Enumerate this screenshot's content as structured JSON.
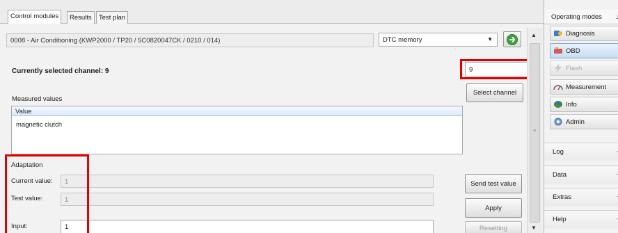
{
  "tabs": [
    {
      "label": "Control modules",
      "active": true
    },
    {
      "label": "Results",
      "active": false
    },
    {
      "label": "Test plan",
      "active": false
    }
  ],
  "module": {
    "name": "0008 - Air Conditioning  (KWP2000 / TP20 / 5C0820047CK  / 0210 / 014)",
    "function_select": "DTC memory",
    "go_icon": "green-arrow-right-icon"
  },
  "channel": {
    "title": "Currently selected channel: 9",
    "input_value": "9",
    "select_button": "Select channel"
  },
  "measured": {
    "heading": "Measured values",
    "column": "Value",
    "rows": [
      "magnetic clutch"
    ]
  },
  "adaptation": {
    "heading": "Adaptation",
    "current_label": "Current value:",
    "current_value": "1",
    "test_label": "Test value:",
    "test_value": "1",
    "input_label": "Input:",
    "input_value": "1",
    "send_button": "Send test value",
    "apply_button": "Apply",
    "reset_button": "Resetting"
  },
  "sidebar": {
    "header": "Operating modes",
    "pin_icon": "pin-icon",
    "modes": [
      {
        "label": "Diagnosis",
        "icon": "diagnosis-icon",
        "selected": false,
        "enabled": true
      },
      {
        "label": "OBD",
        "icon": "obd-icon",
        "selected": true,
        "enabled": true
      },
      {
        "label": "Flash",
        "icon": "flash-icon",
        "selected": false,
        "enabled": false
      },
      {
        "label": "Measurement",
        "icon": "measurement-icon",
        "selected": false,
        "enabled": true
      },
      {
        "label": "Info",
        "icon": "info-icon",
        "selected": false,
        "enabled": true
      },
      {
        "label": "Admin",
        "icon": "admin-icon",
        "selected": false,
        "enabled": true
      }
    ],
    "sections": [
      "Log",
      "Data",
      "Extras",
      "Help"
    ]
  },
  "highlight_color": "#e30000"
}
